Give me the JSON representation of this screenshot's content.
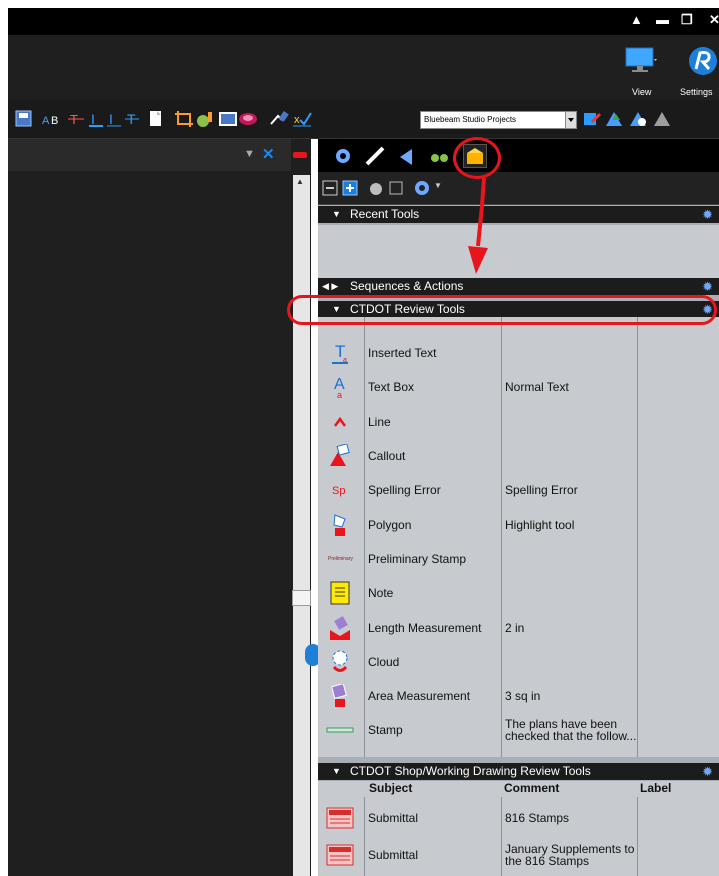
{
  "window": {
    "controls": [
      "▲",
      "▬",
      "❐",
      "✕"
    ]
  },
  "ribbon": {
    "view_label": "View",
    "settings_label": "Settings"
  },
  "toolbar": {
    "studio_select_value": "Bluebeam Studio Projects"
  },
  "left_panel": {
    "dropdown_icon": "▼",
    "close_icon": "✕"
  },
  "right_panel": {
    "tabs": [
      "settings-gear",
      "measure-ruler",
      "markup-tool",
      "binoculars",
      "tool-chest"
    ],
    "sections": {
      "recent": {
        "title": "Recent Tools",
        "arrow": "▼"
      },
      "sequences": {
        "title": "Sequences & Actions",
        "arrow": "◀ ▶"
      },
      "ctdot": {
        "title": "CTDOT Review Tools",
        "arrow": "▼"
      },
      "shop": {
        "title": "CTDOT Shop/Working Drawing Review Tools",
        "arrow": "▼"
      }
    },
    "columns": {
      "subject": "Subject",
      "comment": "Comment",
      "label": "Label"
    },
    "ctdot_rows": [
      {
        "icon": "inserted-text-icon",
        "subject": "Inserted Text",
        "comment": ""
      },
      {
        "icon": "text-box-icon",
        "subject": "Text Box",
        "comment": "Normal Text"
      },
      {
        "icon": "line-icon",
        "subject": "Line",
        "comment": ""
      },
      {
        "icon": "callout-icon",
        "subject": "Callout",
        "comment": ""
      },
      {
        "icon": "spelling-error-icon",
        "subject": "Spelling Error",
        "comment": "Spelling Error"
      },
      {
        "icon": "polygon-icon",
        "subject": "Polygon",
        "comment": "Highlight tool"
      },
      {
        "icon": "preliminary-stamp-icon",
        "subject": "Preliminary Stamp",
        "comment": ""
      },
      {
        "icon": "note-icon",
        "subject": "Note",
        "comment": ""
      },
      {
        "icon": "length-measurement-icon",
        "subject": "Length Measurement",
        "comment": "2 in"
      },
      {
        "icon": "cloud-icon",
        "subject": "Cloud",
        "comment": ""
      },
      {
        "icon": "area-measurement-icon",
        "subject": "Area Measurement",
        "comment": "3 sq in"
      },
      {
        "icon": "stamp-icon",
        "subject": "Stamp",
        "comment": "The plans have been checked that the follow..."
      }
    ],
    "shop_rows": [
      {
        "icon": "submittal-stamp-icon",
        "subject": "Submittal",
        "comment": "816 Stamps"
      },
      {
        "icon": "submittal-stamp-icon",
        "subject": "Submittal",
        "comment": "January Supplements to the 816 Stamps"
      }
    ],
    "icon_texts": {
      "sp": "Sp",
      "preliminary": "Preliminary"
    }
  },
  "colors": {
    "accent_red": "#e8161c",
    "panel_gray": "#a9aeb4",
    "row_gray": "#c7cbcf",
    "gear_blue": "#6ea8ff"
  }
}
